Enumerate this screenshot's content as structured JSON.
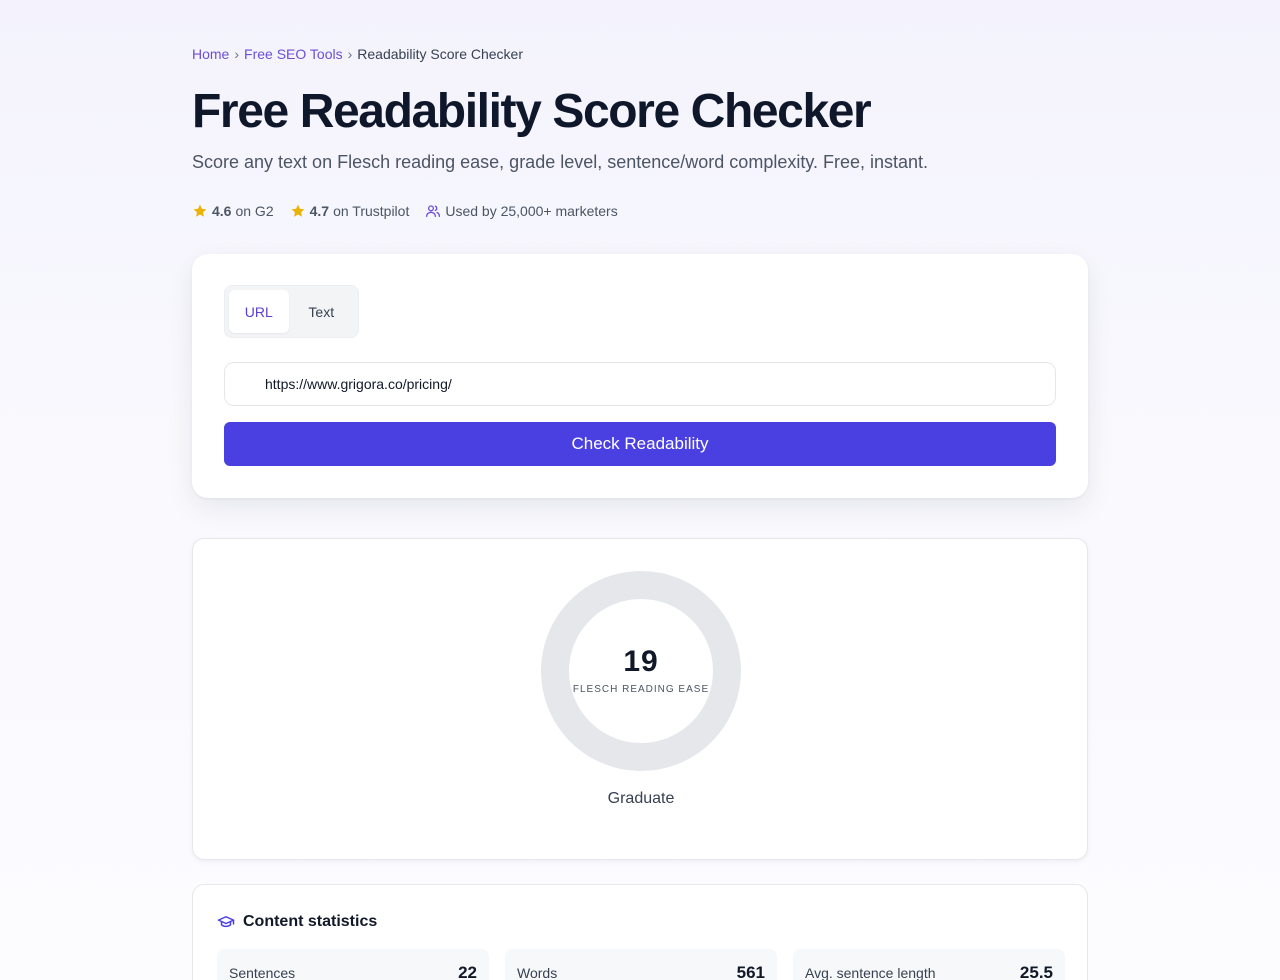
{
  "breadcrumb": {
    "items": [
      "Home",
      "Free SEO Tools",
      "Readability Score Checker"
    ],
    "separator": "›"
  },
  "page": {
    "title": "Free Readability Score Checker",
    "subtitle": "Score any text on Flesch reading ease, grade level, sentence/word complexity. Free, instant."
  },
  "ratings": [
    {
      "score": "4.6",
      "source": "on G2",
      "icon": "star-icon"
    },
    {
      "score": "4.7",
      "source": "on Trustpilot",
      "icon": "star-icon"
    }
  ],
  "usage": {
    "text": "Used by 25,000+ marketers",
    "icon": "users-icon"
  },
  "input_card": {
    "tabs": [
      {
        "label": "URL",
        "active": true
      },
      {
        "label": "Text",
        "active": false
      }
    ],
    "url_value": "https://www.grigora.co/pricing/",
    "button_label": "Check Readability"
  },
  "score_card": {
    "score": "19",
    "score_value": 19,
    "score_max": 100,
    "caption": "FLESCH READING EASE",
    "level": "Graduate",
    "colors": {
      "arc": "#ef4444",
      "track": "#e5e7eb"
    }
  },
  "stats_card": {
    "title": "Content statistics",
    "icon": "graduation-cap-icon",
    "items": [
      {
        "label": "Sentences",
        "value": "22"
      },
      {
        "label": "Words",
        "value": "561"
      },
      {
        "label": "Avg. sentence length",
        "value": "25.5"
      }
    ]
  },
  "colors": {
    "accent": "#4a3fe0",
    "link": "#6d4fd6",
    "star": "#eab308"
  }
}
